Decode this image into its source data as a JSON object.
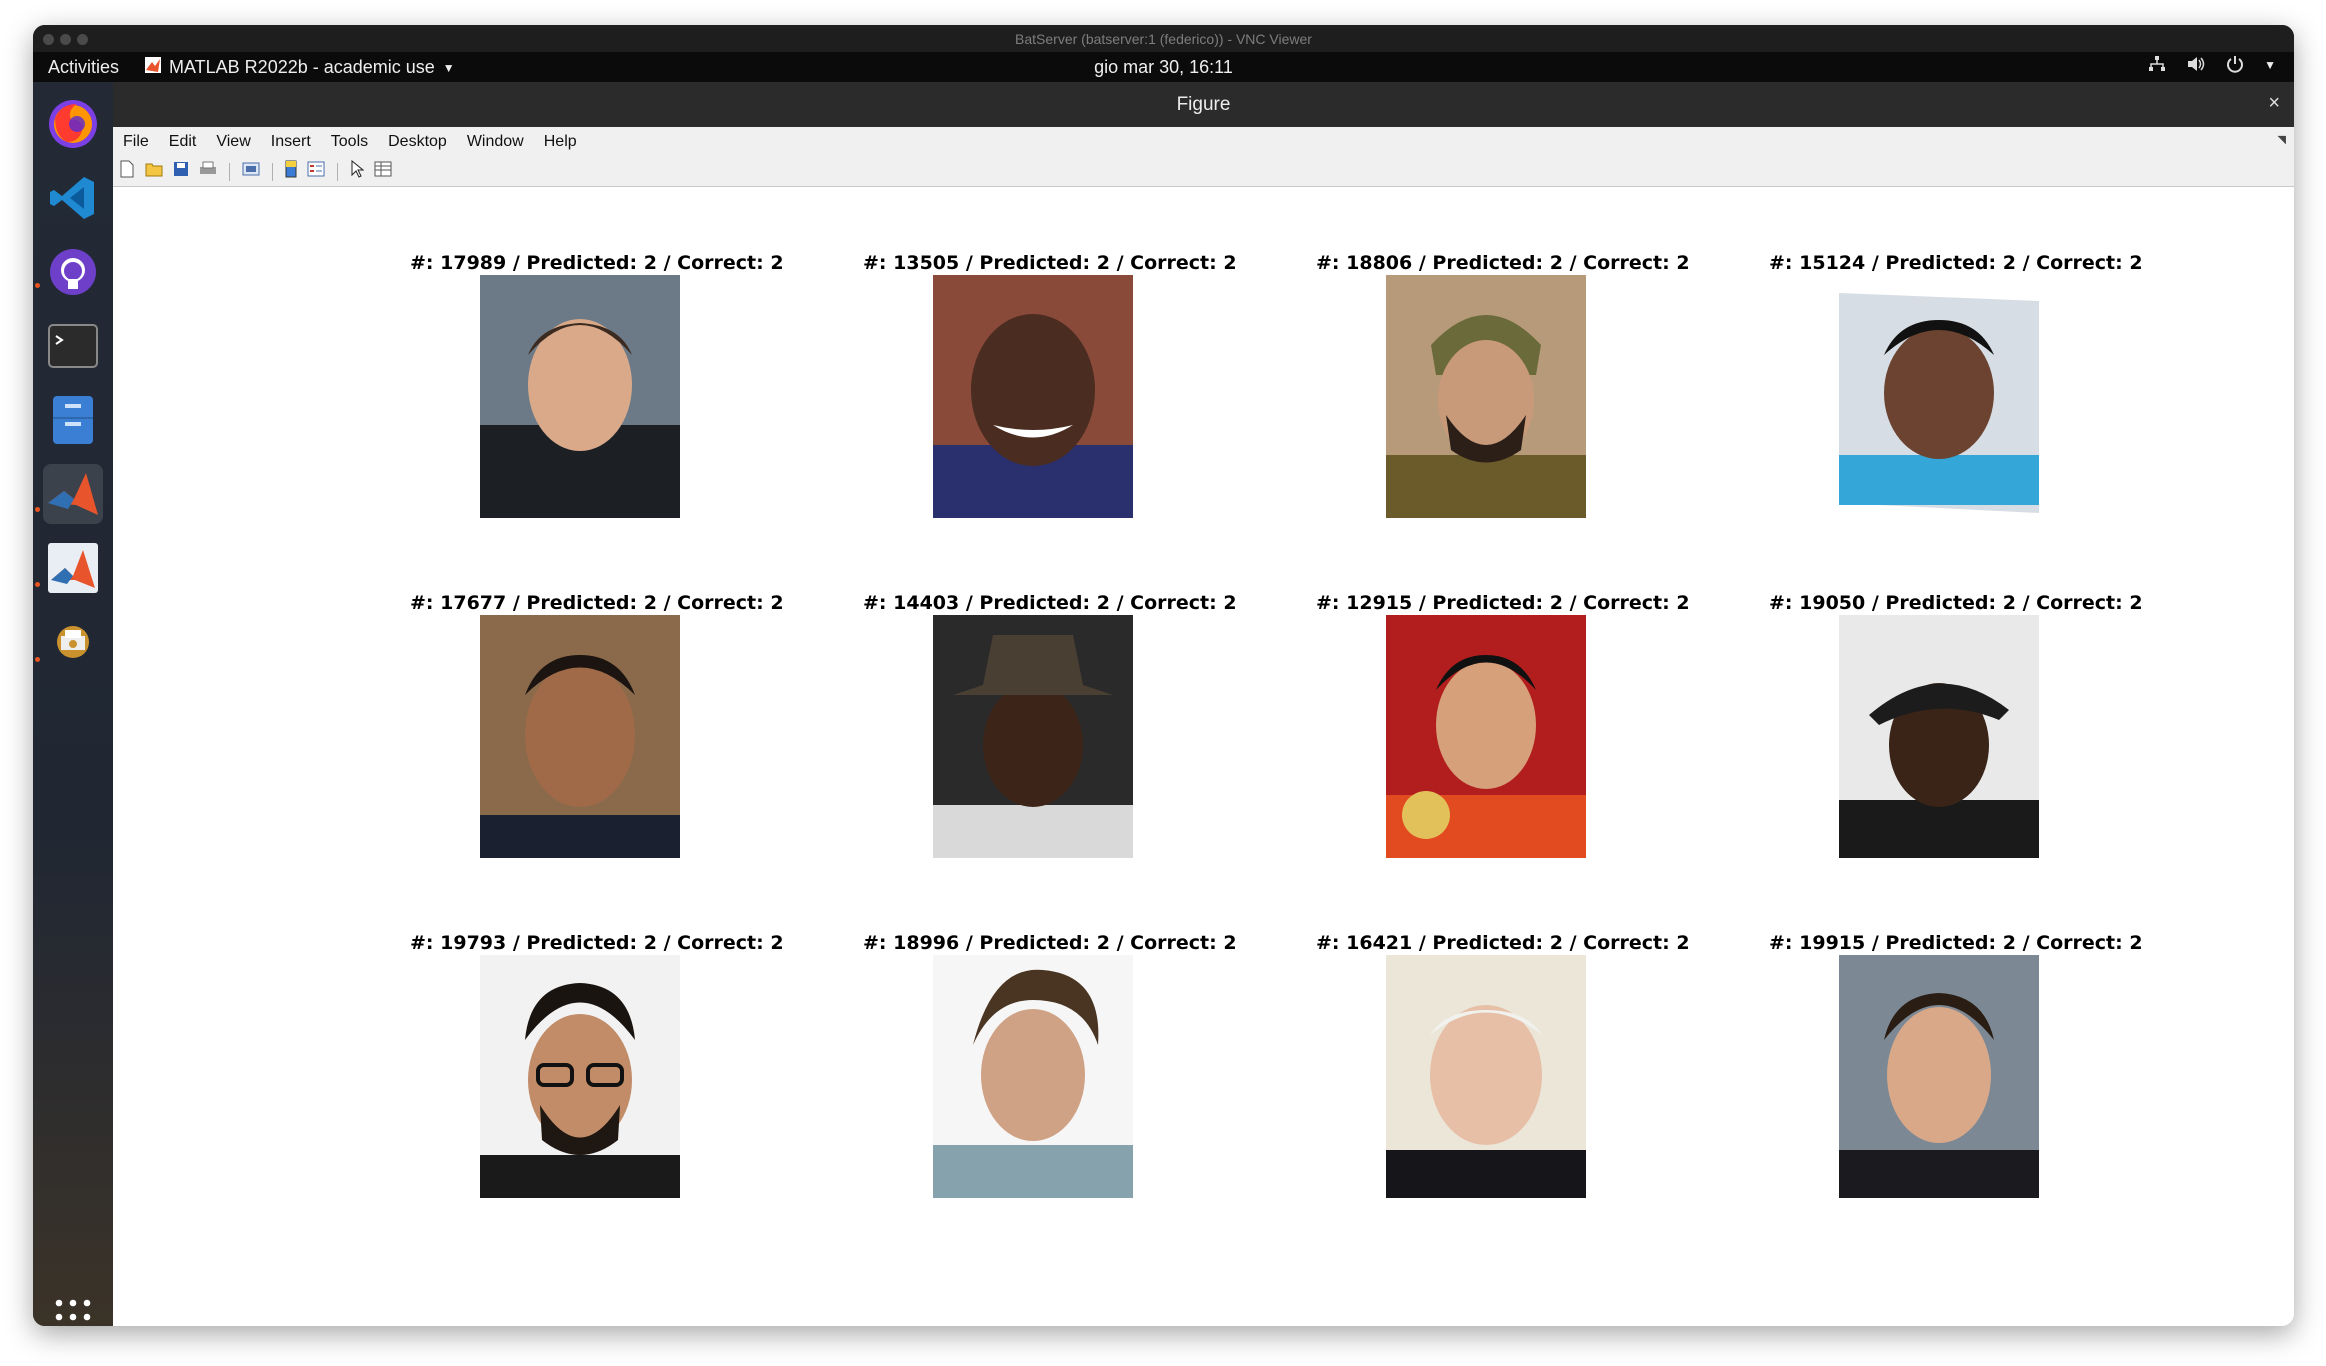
{
  "vnc": {
    "title": "BatServer (batserver:1 (federico)) - VNC Viewer"
  },
  "topbar": {
    "activities": "Activities",
    "app_menu": "MATLAB R2022b - academic use",
    "clock": "gio mar 30, 16:11"
  },
  "dock": {
    "items": [
      "firefox-icon",
      "vscode-icon",
      "github-desktop-icon",
      "terminal-icon",
      "files-icon",
      "matlab-icon",
      "matlab-installer-icon",
      "printer-settings-icon",
      "show-apps-icon"
    ]
  },
  "figure": {
    "title": "Figure",
    "close": "×",
    "menu": [
      "File",
      "Edit",
      "View",
      "Insert",
      "Tools",
      "Desktop",
      "Window",
      "Help"
    ],
    "subplots": [
      {
        "title": "#: 17989 / Predicted: 2 / Correct: 2"
      },
      {
        "title": "#: 13505 / Predicted: 2 / Correct: 2"
      },
      {
        "title": "#: 18806 / Predicted: 2 / Correct: 2"
      },
      {
        "title": "#: 15124 / Predicted: 2 / Correct: 2"
      },
      {
        "title": "#: 17677 / Predicted: 2 / Correct: 2"
      },
      {
        "title": "#: 14403 / Predicted: 2 / Correct: 2"
      },
      {
        "title": "#: 12915 / Predicted: 2 / Correct: 2"
      },
      {
        "title": "#: 19050 / Predicted: 2 / Correct: 2"
      },
      {
        "title": "#: 19793 / Predicted: 2 / Correct: 2"
      },
      {
        "title": "#: 18996 / Predicted: 2 / Correct: 2"
      },
      {
        "title": "#: 16421 / Predicted: 2 / Correct: 2"
      },
      {
        "title": "#: 19915 / Predicted: 2 / Correct: 2"
      }
    ]
  },
  "colors": {
    "dock_active_dot": "#e95420",
    "topbar_bg": "#0b0b0b",
    "figure_titlebar_bg": "#2b2b2b"
  }
}
